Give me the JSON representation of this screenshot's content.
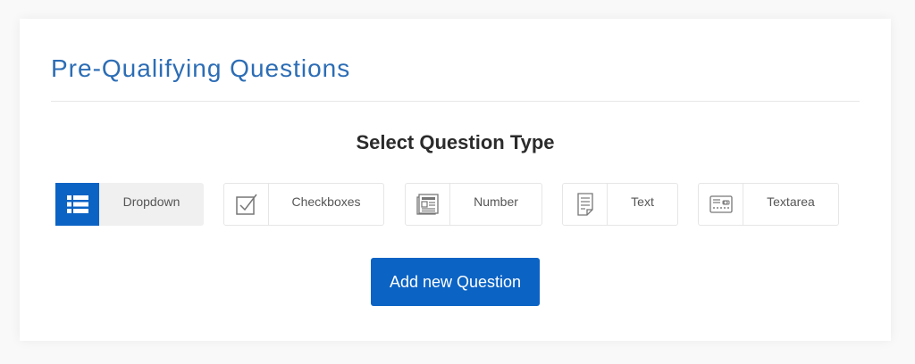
{
  "page": {
    "title": "Pre-Qualifying Questions",
    "section_heading": "Select Question Type"
  },
  "question_types": [
    {
      "label": "Dropdown",
      "icon": "list-icon",
      "selected": true
    },
    {
      "label": "Checkboxes",
      "icon": "checkbox-icon",
      "selected": false
    },
    {
      "label": "Number",
      "icon": "number-icon",
      "selected": false
    },
    {
      "label": "Text",
      "icon": "text-icon",
      "selected": false
    },
    {
      "label": "Textarea",
      "icon": "textarea-icon",
      "selected": false
    }
  ],
  "actions": {
    "add_label": "Add new Question"
  },
  "colors": {
    "accent": "#0b63c4",
    "title": "#2c6db5"
  }
}
